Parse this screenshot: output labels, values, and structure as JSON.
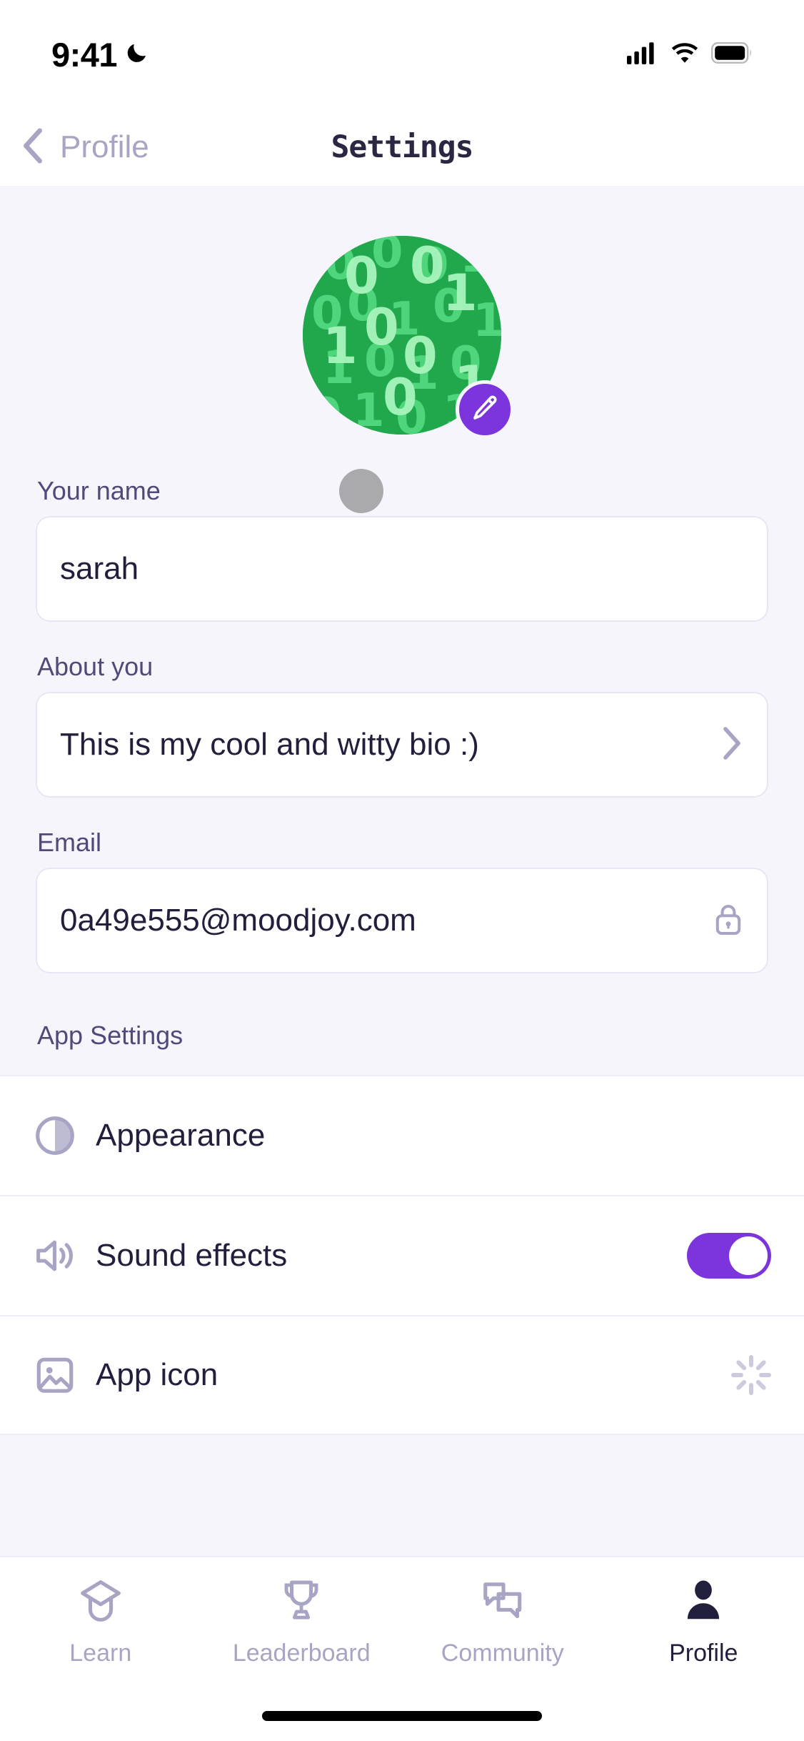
{
  "status_bar": {
    "time": "9:41",
    "dnd_icon": "crescent-moon-icon",
    "cellular_icon": "cellular-signal-icon",
    "wifi_icon": "wifi-icon",
    "battery_icon": "battery-full-icon"
  },
  "header": {
    "back_label": "Profile",
    "back_icon": "chevron-left-icon",
    "title": "Settings"
  },
  "profile": {
    "avatar_alt": "binary-code-avatar",
    "avatar_bg_color": "#21a84c",
    "avatar_digit_color": "#5fe08a",
    "avatar_digits": [
      "0",
      "0",
      "1",
      "0",
      "0",
      "1",
      "0",
      "1",
      "1",
      "0",
      "1",
      "0",
      "1",
      "0",
      "1",
      "0",
      "0",
      "1"
    ],
    "edit_button_icon": "pencil-icon",
    "edit_button_color": "#7c35dd"
  },
  "fields": {
    "name": {
      "label": "Your name",
      "value": "sarah",
      "placeholder": "Your name"
    },
    "bio": {
      "label": "About you",
      "value": "This is my cool and witty bio :)",
      "placeholder": "About you",
      "chevron_icon": "chevron-right-icon"
    },
    "email": {
      "label": "Email",
      "value": "0a49e555@moodjoy.com",
      "placeholder": "Email",
      "lock_icon": "lock-icon",
      "readonly": "true"
    }
  },
  "app_settings": {
    "section_label": "App Settings",
    "rows": [
      {
        "label": "Appearance",
        "icon": "contrast-circle-icon",
        "trailing": "none"
      },
      {
        "label": "Sound effects",
        "icon": "speaker-wave-icon",
        "trailing": "toggle",
        "toggle_on": true,
        "toggle_color": "#7c35dd"
      },
      {
        "label": "App icon",
        "icon": "image-icon",
        "trailing": "spinner"
      }
    ]
  },
  "tab_bar": {
    "tabs": [
      {
        "label": "Learn",
        "icon": "graduation-cap-icon",
        "active": false
      },
      {
        "label": "Leaderboard",
        "icon": "trophy-icon",
        "active": false
      },
      {
        "label": "Community",
        "icon": "chat-bubbles-icon",
        "active": false
      },
      {
        "label": "Profile",
        "icon": "person-icon",
        "active": true
      }
    ],
    "home_indicator": "home-indicator"
  },
  "colors": {
    "accent_purple": "#7c35dd",
    "page_bg": "#f6f5fc",
    "card_bg": "#ffffff",
    "text_dark": "#221f3d",
    "text_muted": "#a8a5c4",
    "label_purple": "#4f4a7a"
  }
}
